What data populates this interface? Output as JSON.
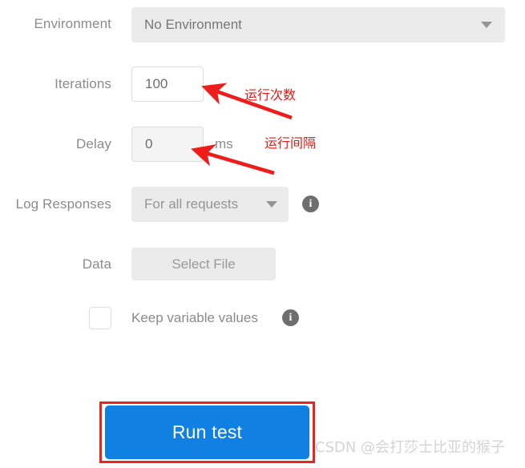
{
  "form": {
    "environment": {
      "label": "Environment",
      "selected_value": "No Environment",
      "caret_icon": "chevron-down-icon"
    },
    "iterations": {
      "label": "Iterations",
      "value": "100"
    },
    "delay": {
      "label": "Delay",
      "value": "0",
      "unit": "ms"
    },
    "log_responses": {
      "label": "Log Responses",
      "selected_value": "For all requests",
      "caret_icon": "chevron-down-icon",
      "info_icon": "info-icon",
      "info_glyph": "i"
    },
    "data": {
      "label": "Data",
      "button_label": "Select File"
    },
    "keep_variable_values": {
      "label": "Keep variable values",
      "checked": false,
      "info_icon": "info-icon",
      "info_glyph": "i"
    },
    "run_button": {
      "label": "Run test"
    }
  },
  "annotations": [
    {
      "text": "运行次数",
      "target": "iterations-input"
    },
    {
      "text": "运行间隔",
      "target": "delay-input"
    }
  ],
  "watermark": {
    "text": "CSDN @会打莎士比亚的猴子"
  },
  "colors": {
    "accent_blue": "#1180e3",
    "annotation_red": "#f01414",
    "highlight_red": "#e8251f",
    "control_gray": "#ebebeb",
    "label_gray": "#8c8c8c",
    "watermark_gray": "#d4d4d4"
  }
}
